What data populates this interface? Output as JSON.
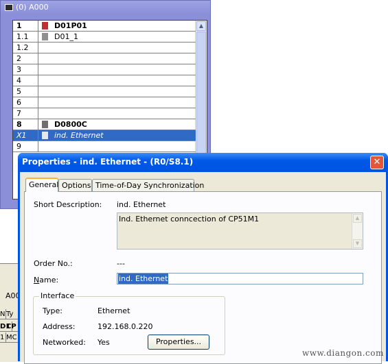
{
  "rack_window": {
    "title": "(0) A000",
    "rows": [
      {
        "slot": "1",
        "module": "D01P01",
        "icon": "rack-icon",
        "bold": true
      },
      {
        "slot": "1.1",
        "module": "D01_1",
        "icon": "module-icon",
        "bold": false
      },
      {
        "slot": "1.2",
        "module": ""
      },
      {
        "slot": "2",
        "module": ""
      },
      {
        "slot": "3",
        "module": ""
      },
      {
        "slot": "4",
        "module": ""
      },
      {
        "slot": "5",
        "module": ""
      },
      {
        "slot": "6",
        "module": ""
      },
      {
        "slot": "7",
        "module": ""
      },
      {
        "slot": "8",
        "module": "D0800C",
        "icon": "cpu-icon",
        "bold": true
      },
      {
        "slot": "X1",
        "module": "ind. Ethernet",
        "icon": "ethernet-icon",
        "selected": true
      },
      {
        "slot": "9",
        "module": ""
      }
    ]
  },
  "lower_window": {
    "label": "A00",
    "headers": [
      "N",
      "Ty"
    ],
    "cells": [
      "D1",
      "CP",
      "1",
      "MC"
    ]
  },
  "dialog": {
    "title": "Properties - ind. Ethernet - (R0/S8.1)",
    "close_glyph": "✕",
    "tabs": [
      "General",
      "Options",
      "Time-of-Day Synchronization"
    ],
    "short_description_label": "Short Description:",
    "short_description_value": "ind. Ethernet",
    "comment_text": "Ind. Ethernet conncection of CP51M1",
    "order_no_label": "Order No.:",
    "order_no_value": "---",
    "name_label": "Name:",
    "name_value": "ind. Ethernet",
    "interface": {
      "legend": "Interface",
      "type_label": "Type:",
      "type_value": "Ethernet",
      "address_label": "Address:",
      "address_value": "192.168.0.220",
      "networked_label": "Networked:",
      "networked_value": "Yes",
      "properties_button": "Properties..."
    }
  },
  "watermark": "www.diangon.com"
}
